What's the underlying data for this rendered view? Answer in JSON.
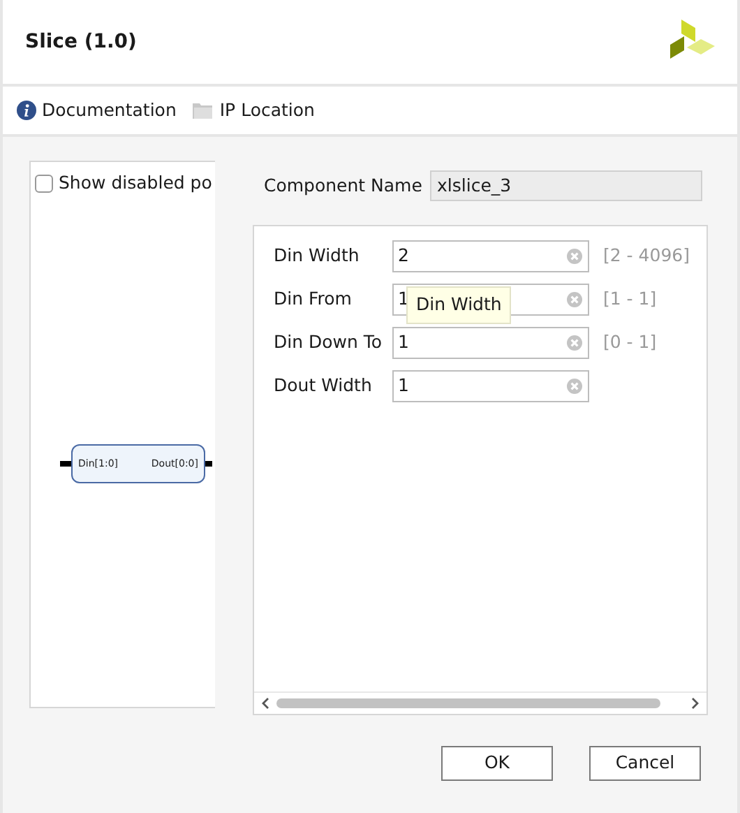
{
  "window": {
    "title": "Slice (1.0)"
  },
  "toolbar": [
    {
      "kind": "info",
      "label": "Documentation"
    },
    {
      "kind": "folder",
      "label": "IP Location"
    }
  ],
  "symbol_panel": {
    "show_disabled": {
      "label": "Show disabled po",
      "checked": false
    },
    "block": {
      "input": "Din[1:0]",
      "output": "Dout[0:0]"
    }
  },
  "component_name": {
    "label": "Component Name",
    "value": "xlslice_3"
  },
  "params": [
    {
      "label": "Din Width",
      "value": "2",
      "range": "[2 - 4096]"
    },
    {
      "label": "Din From",
      "value": "1",
      "range": "[1 - 1]"
    },
    {
      "label": "Din Down To",
      "value": "1",
      "range": "[0 - 1]"
    },
    {
      "label": "Dout Width",
      "value": "1"
    }
  ],
  "tooltip": "Din Width",
  "buttons": [
    "OK",
    "Cancel"
  ]
}
